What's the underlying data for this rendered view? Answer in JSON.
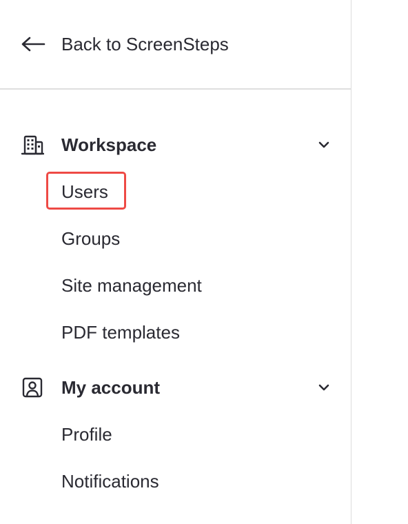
{
  "back": {
    "label": "Back to ScreenSteps",
    "icon": "arrow-left-icon"
  },
  "sections": [
    {
      "title": "Workspace",
      "icon": "building-icon",
      "expanded": true,
      "items": [
        {
          "label": "Users",
          "highlighted": true
        },
        {
          "label": "Groups"
        },
        {
          "label": "Site management"
        },
        {
          "label": "PDF templates"
        }
      ]
    },
    {
      "title": "My account",
      "icon": "user-badge-icon",
      "expanded": true,
      "items": [
        {
          "label": "Profile"
        },
        {
          "label": "Notifications"
        }
      ]
    }
  ],
  "colors": {
    "text": "#2a2a32",
    "highlight": "#ee4a45",
    "divider": "#dedede"
  }
}
